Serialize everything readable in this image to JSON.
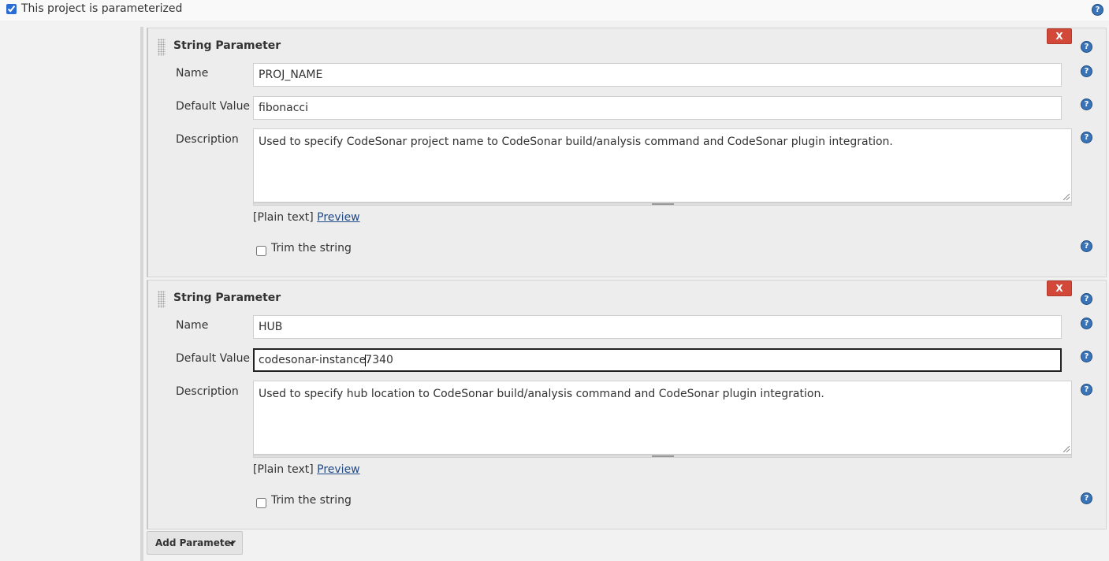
{
  "header": {
    "parameterized_label": "This project is parameterized",
    "parameterized_checked": true,
    "help_glyph": "?"
  },
  "parameters": [
    {
      "type_label": "String Parameter",
      "delete_label": "X",
      "name_label": "Name",
      "name_value": "PROJ_NAME",
      "default_label": "Default Value",
      "default_value": "fibonacci",
      "description_label": "Description",
      "description_value": "Used to specify CodeSonar project name to CodeSonar build/analysis command and CodeSonar plugin integration.",
      "markup_label": "[Plain text]",
      "preview_label": "Preview",
      "trim_label": "Trim the string",
      "trim_checked": false
    },
    {
      "type_label": "String Parameter",
      "delete_label": "X",
      "name_label": "Name",
      "name_value": "HUB",
      "default_label": "Default Value",
      "default_value_before_caret": "codesonar-instance",
      "default_value_after_caret": "7340",
      "description_label": "Description",
      "description_value": "Used to specify hub location to CodeSonar build/analysis command and CodeSonar plugin integration.",
      "markup_label": "[Plain text]",
      "preview_label": "Preview",
      "trim_label": "Trim the string",
      "trim_checked": false
    }
  ],
  "footer": {
    "add_parameter_label": "Add Parameter"
  },
  "colors": {
    "delete_button": "#d24939",
    "help_icon": "#3a74b8",
    "link": "#204a87"
  },
  "icons": [
    "help-icon",
    "drag-handle-icon",
    "dropdown-caret-icon"
  ]
}
